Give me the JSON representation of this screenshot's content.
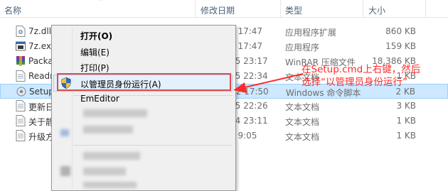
{
  "header": {
    "col_name": "名称",
    "col_date": "修改日期",
    "col_type": "类型",
    "col_size": "大小"
  },
  "files": [
    {
      "name": "7z.dll",
      "date": "8 17:47",
      "type": "应用程序扩展",
      "size": "860 KB",
      "icon": "dll-file-icon"
    },
    {
      "name": "7z.exe",
      "date": "8 17:47",
      "type": "应用程序",
      "size": "159 KB",
      "icon": "exe-file-icon"
    },
    {
      "name": "Packag",
      "date": "25 23:17",
      "type": "WinRAR 压缩文件",
      "size": "18,386 KB",
      "icon": "archive-file-icon"
    },
    {
      "name": "Readm",
      "date": "25 22:34",
      "type": "文本文档",
      "size": "1 KB",
      "icon": "text-file-icon"
    },
    {
      "name": "Setup.",
      "date": "22 17:50",
      "type": "Windows 命令脚本",
      "size": "2 KB",
      "icon": "cmd-file-icon"
    },
    {
      "name": "更新日",
      "date": "25 22:26",
      "type": "文本文档",
      "size": "3 KB",
      "icon": "text-file-icon"
    },
    {
      "name": "关于静",
      "date": "24 23:11",
      "type": "文本文档",
      "size": "1 KB",
      "icon": "text-file-icon"
    },
    {
      "name": "升级方",
      "date": "4 9:05",
      "type": "文本文档",
      "size": "1 KB",
      "icon": "text-file-icon"
    }
  ],
  "menu": {
    "open": "打开(O)",
    "edit": "编辑(E)",
    "print": "打印(P)",
    "run_as_admin": "以管理员身份运行(A)",
    "emeditor": "EmEditor"
  },
  "annotation": {
    "line1": "在Setup.cmd上右键，然后",
    "line2": "选择“以管理员身份运行”",
    "color": "#ff2a2a"
  },
  "colors": {
    "selection": "#cde8ff",
    "menu_bg": "#f0f0f0",
    "highlight_border": "#e24a4a"
  }
}
